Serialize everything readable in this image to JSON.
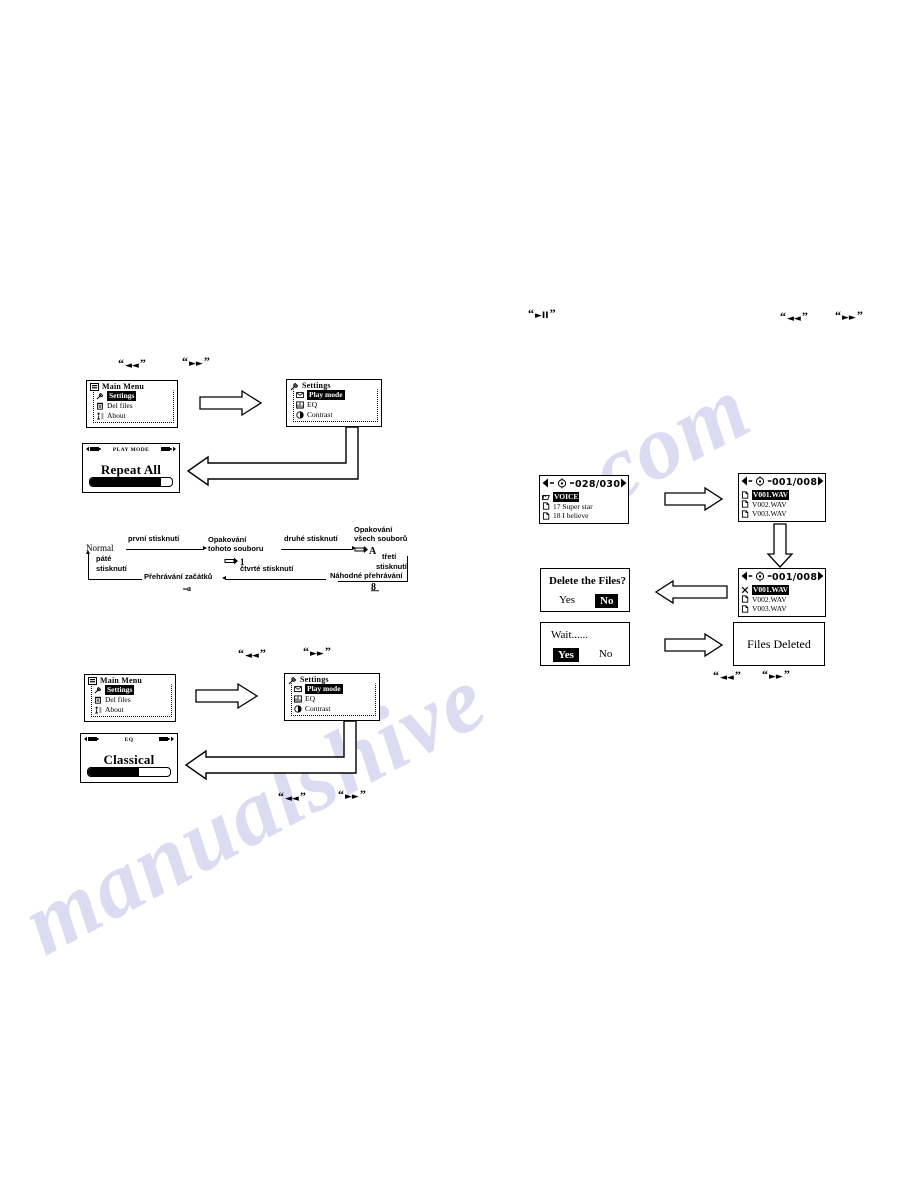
{
  "watermark": {
    "left_text": "manualshive",
    "right_text": ".com"
  },
  "button_captions": {
    "prev": "◄◄",
    "next": "►►",
    "playpause": "►II",
    "quote_open": "“",
    "quote_close": "”"
  },
  "section_playmode": {
    "main_menu": {
      "title": "Main Menu",
      "title_icon": "menu-icon",
      "items": [
        {
          "label": "Settings",
          "icon": "settings-wrench-icon",
          "selected": true
        },
        {
          "label": "Del files",
          "icon": "trash-icon",
          "selected": false
        },
        {
          "label": "About",
          "icon": "info-icon",
          "selected": false
        }
      ]
    },
    "settings_menu": {
      "title": "Settings",
      "title_icon": "settings-wrench-icon",
      "items": [
        {
          "label": "Play mode",
          "icon": "playmode-icon",
          "selected": true
        },
        {
          "label": "EQ",
          "icon": "eq-icon",
          "selected": false
        },
        {
          "label": "Contrast",
          "icon": "contrast-icon",
          "selected": false
        }
      ]
    },
    "result_screen": {
      "header": "PLAY MODE",
      "title": "Repeat All",
      "progress_percent": 86,
      "left_icon": "prev-battery-icon",
      "right_icon": "battery-icon"
    }
  },
  "section_eq": {
    "main_menu": {
      "title": "Main Menu",
      "title_icon": "menu-icon",
      "items": [
        {
          "label": "Settings",
          "icon": "settings-wrench-icon",
          "selected": true
        },
        {
          "label": "Del files",
          "icon": "trash-icon",
          "selected": false
        },
        {
          "label": "About",
          "icon": "info-icon",
          "selected": false
        }
      ]
    },
    "settings_menu": {
      "title": "Settings",
      "title_icon": "settings-wrench-icon",
      "items": [
        {
          "label": "Play mode",
          "icon": "playmode-icon",
          "selected": true
        },
        {
          "label": "EQ",
          "icon": "eq-icon",
          "selected": false
        },
        {
          "label": "Contrast",
          "icon": "contrast-icon",
          "selected": false
        }
      ]
    },
    "result_screen": {
      "header": "EQ",
      "title": "Classical",
      "progress_percent": 62,
      "left_icon": "prev-battery-icon",
      "right_icon": "battery-icon"
    }
  },
  "section_delete": {
    "browse_screen": {
      "counter": "028/030",
      "left_arrow_icon": "left-triangle-icon",
      "right_arrow_icon": "right-triangle-icon",
      "center_icon": "navwheel-icon",
      "rows": [
        {
          "label": "VOICE",
          "icon": "folder-icon",
          "selected": true
        },
        {
          "label": "17 Super star",
          "icon": "file-icon",
          "selected": false
        },
        {
          "label": "18 I believe",
          "icon": "file-icon",
          "selected": false
        }
      ]
    },
    "file_list_screen": {
      "counter": "001/008",
      "left_arrow_icon": "left-triangle-icon",
      "right_arrow_icon": "right-triangle-icon",
      "center_icon": "navwheel-icon",
      "rows": [
        {
          "label": "V001.WAV",
          "icon": "file-icon",
          "selected": true,
          "marked": false
        },
        {
          "label": "V002.WAV",
          "icon": "file-icon",
          "selected": false,
          "marked": false
        },
        {
          "label": "V003.WAV",
          "icon": "file-icon",
          "selected": false,
          "marked": false
        }
      ]
    },
    "file_list_marked_screen": {
      "counter": "001/008",
      "left_arrow_icon": "left-triangle-icon",
      "right_arrow_icon": "right-triangle-icon",
      "center_icon": "navwheel-icon",
      "rows": [
        {
          "label": "V001.WAV",
          "icon": "cross-mark-icon",
          "selected": true,
          "marked": true
        },
        {
          "label": "V002.WAV",
          "icon": "file-icon",
          "selected": false,
          "marked": false
        },
        {
          "label": "V003.WAV",
          "icon": "file-icon",
          "selected": false,
          "marked": false
        }
      ]
    },
    "confirm_screen": {
      "question": "Delete the Files?",
      "yes_label": "Yes",
      "no_label": "No",
      "selected": "No"
    },
    "wait_screen": {
      "question": "Wait......",
      "yes_label": "Yes",
      "no_label": "No",
      "selected": "Yes"
    },
    "done_screen": {
      "message": "Files Deleted"
    }
  },
  "playmode_flow": {
    "nodes": {
      "normal": "Normal",
      "repeat_one_l1": "Opakování",
      "repeat_one_l2": "tohoto souboru",
      "repeat_one_sym": "1",
      "repeat_all_l1": "Opakování",
      "repeat_all_l2": "všech souborů",
      "repeat_all_sym": "A",
      "random": "Náhodné přehrávání",
      "random_sym": "8",
      "intro_l1": "Přehrávání začátků",
      "intro_sym": "a"
    },
    "labels": {
      "first": "první stisknutí",
      "second": "druhé stisknutí",
      "third_l1": "třetí",
      "third_l2": "stisknutí",
      "fourth": "čtvrté stisknutí",
      "fifth_l1": "páté",
      "fifth_l2": "stisknutí"
    }
  }
}
